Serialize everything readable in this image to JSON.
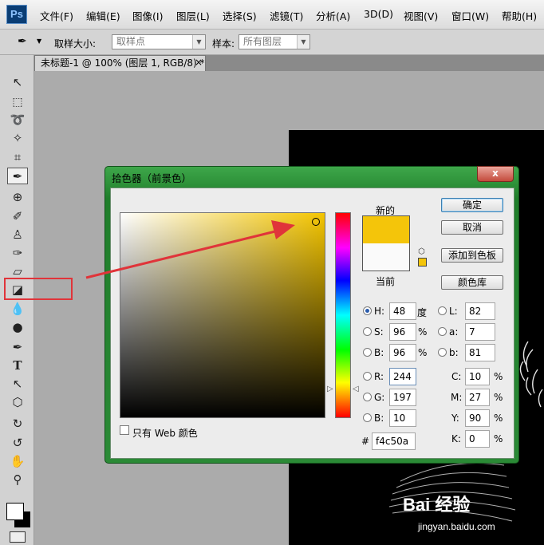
{
  "app": {
    "logo": "Ps"
  },
  "menu": [
    "文件(F)",
    "编辑(E)",
    "图像(I)",
    "图层(L)",
    "选择(S)",
    "滤镜(T)",
    "分析(A)",
    "3D(D)",
    "视图(V)",
    "窗口(W)",
    "帮助(H)"
  ],
  "options": {
    "sample_size_label": "取样大小:",
    "sample_size_value": "取样点",
    "sample_label": "样本:",
    "sample_value": "所有图层"
  },
  "document_tab": {
    "title": "未标题-1 @ 100% (图层 1, RGB/8) *",
    "close": "×"
  },
  "tools": [
    "move-tool-icon",
    "marquee-tool-icon",
    "lasso-tool-icon",
    "magic-wand-icon",
    "crop-tool-icon",
    "eyedropper-tool-icon",
    "healing-brush-icon",
    "brush-tool-icon",
    "clone-stamp-icon",
    "history-brush-icon",
    "eraser-tool-icon",
    "paint-bucket-icon",
    "blur-tool-icon",
    "dodge-tool-icon",
    "pen-tool-icon",
    "type-tool-icon",
    "path-select-icon",
    "shape-tool-icon",
    "3d-rotate-icon",
    "3d-orbit-icon",
    "hand-tool-icon",
    "zoom-tool-icon"
  ],
  "type_tool_glyph": "T",
  "dialog": {
    "title": "拾色器（前景色）",
    "close": "x",
    "new_label": "新的",
    "current_label": "当前",
    "ok": "确定",
    "cancel": "取消",
    "add_to_swatches": "添加到色板",
    "color_libraries": "颜色库",
    "web_only": "只有 Web 颜色",
    "hex_label": "#",
    "hex": "f4c50a",
    "new_color": "#f4c50a",
    "current_color": "#fafafa",
    "hsb": {
      "h": "48",
      "s": "96",
      "b": "96",
      "h_unit": "度",
      "pct": "%"
    },
    "rgb": {
      "r": "244",
      "g": "197",
      "b": "10"
    },
    "lab": {
      "l": "82",
      "a": "7",
      "b": "81"
    },
    "cmyk": {
      "c": "10",
      "m": "27",
      "y": "90",
      "k": "0"
    },
    "labels": {
      "h": "H:",
      "s": "S:",
      "bri": "B:",
      "r": "R:",
      "g": "G:",
      "bb": "B:",
      "l": "L:",
      "a": "a:",
      "lb": "b:",
      "c": "C:",
      "m": "M:",
      "y": "Y:",
      "k": "K:"
    }
  },
  "watermark": {
    "brand": "Bai 经验",
    "url": "jingyan.baidu.com"
  },
  "annotation_color": "#e0343a"
}
